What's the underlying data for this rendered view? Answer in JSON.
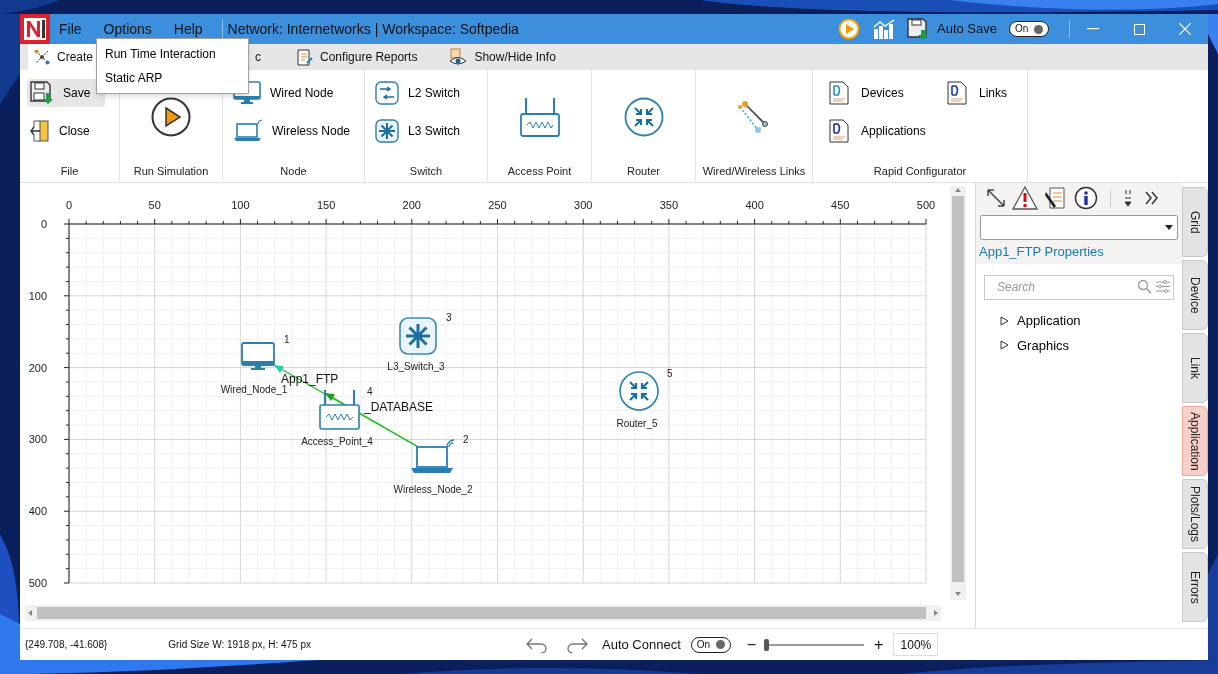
{
  "window": {
    "title": "Network: Internetworks | Workspace: Softpedia",
    "menu": [
      "File",
      "Options",
      "Help"
    ],
    "auto_save": {
      "label": "Auto Save",
      "state": "On",
      "on": true
    }
  },
  "open_menu": {
    "items": [
      "Run Time Interaction",
      "Static ARP"
    ]
  },
  "tabs": [
    {
      "label": "Create",
      "selected": true
    },
    {
      "label": "c",
      "selected": false
    },
    {
      "label": "Configure Reports",
      "selected": false
    },
    {
      "label": "Show/Hide Info",
      "selected": false
    }
  ],
  "ribbon": [
    {
      "label": "File",
      "kind": "list",
      "buttons": [
        {
          "kind": "save",
          "label": "Save",
          "hovered": true
        },
        {
          "kind": "close",
          "label": "Close",
          "hovered": false
        }
      ]
    },
    {
      "label": "Run Simulation",
      "kind": "big",
      "buttons": [
        {
          "kind": "run",
          "hovered": false
        }
      ]
    },
    {
      "label": "Node",
      "kind": "list",
      "buttons": [
        {
          "kind": "wired",
          "label": "Wired Node",
          "hovered": false
        },
        {
          "kind": "wireless",
          "label": "Wireless Node",
          "hovered": false
        }
      ]
    },
    {
      "label": "Switch",
      "kind": "list",
      "buttons": [
        {
          "kind": "l2",
          "label": "L2 Switch",
          "hovered": false
        },
        {
          "kind": "l3",
          "label": "L3 Switch",
          "hovered": false
        }
      ]
    },
    {
      "label": "Access Point",
      "kind": "big",
      "buttons": [
        {
          "kind": "ap",
          "hovered": false
        }
      ]
    },
    {
      "label": "Router",
      "kind": "big",
      "buttons": [
        {
          "kind": "router",
          "hovered": false
        }
      ]
    },
    {
      "label": "Wired/Wireless Links",
      "kind": "big",
      "buttons": [
        {
          "kind": "link",
          "hovered": false
        }
      ]
    },
    {
      "label": "Rapid Configurator",
      "kind": "grid",
      "buttons": [
        {
          "kind": "doc_devices",
          "label": "Devices",
          "hovered": false
        },
        {
          "kind": "doc_links",
          "label": "Links",
          "hovered": false
        },
        {
          "kind": "doc_apps",
          "label": "Applications",
          "hovered": false
        }
      ]
    }
  ],
  "canvas": {
    "x_ticks": [
      "0",
      "50",
      "100",
      "150",
      "200",
      "250",
      "300",
      "350",
      "400",
      "450",
      "500"
    ],
    "y_ticks": [
      "0",
      "100",
      "200",
      "300",
      "400",
      "500"
    ],
    "nodes": [
      {
        "name": "L3_Switch_3",
        "number": "3",
        "kind": "l3"
      },
      {
        "name": "Wired_Node_1",
        "number": "1",
        "kind": "wired"
      },
      {
        "name": "Router_5",
        "number": "5",
        "kind": "router"
      },
      {
        "name": "Access_Point_4",
        "number": "4",
        "kind": "ap"
      },
      {
        "name": "Wireless_Node_2",
        "number": "2",
        "kind": "wireless"
      }
    ],
    "applications": [
      {
        "label": "App1_FTP"
      },
      {
        "label": "_DATABASE"
      }
    ]
  },
  "properties": {
    "title": "App1_FTP Properties",
    "search": {
      "placeholder": "Search"
    },
    "tree": [
      {
        "label": "Application",
        "expanded": false
      },
      {
        "label": "Graphics",
        "expanded": false
      }
    ]
  },
  "side_tabs": [
    {
      "label": "Grid",
      "selected": false
    },
    {
      "label": "Device",
      "selected": false
    },
    {
      "label": "Link",
      "selected": false
    },
    {
      "label": "Application",
      "selected": true
    },
    {
      "label": "Plots/Logs",
      "selected": false
    },
    {
      "label": "Errors",
      "selected": false
    }
  ],
  "status_bar": {
    "coordinates": "{249.708, -41.608}",
    "grid_size": "Grid Size W: 1918 px, H: 475 px",
    "auto_connect": {
      "label": "Auto Connect",
      "state": "On",
      "on": true
    },
    "zoom": {
      "minus": "−",
      "plus": "+",
      "level": 0,
      "value": "100%"
    }
  }
}
